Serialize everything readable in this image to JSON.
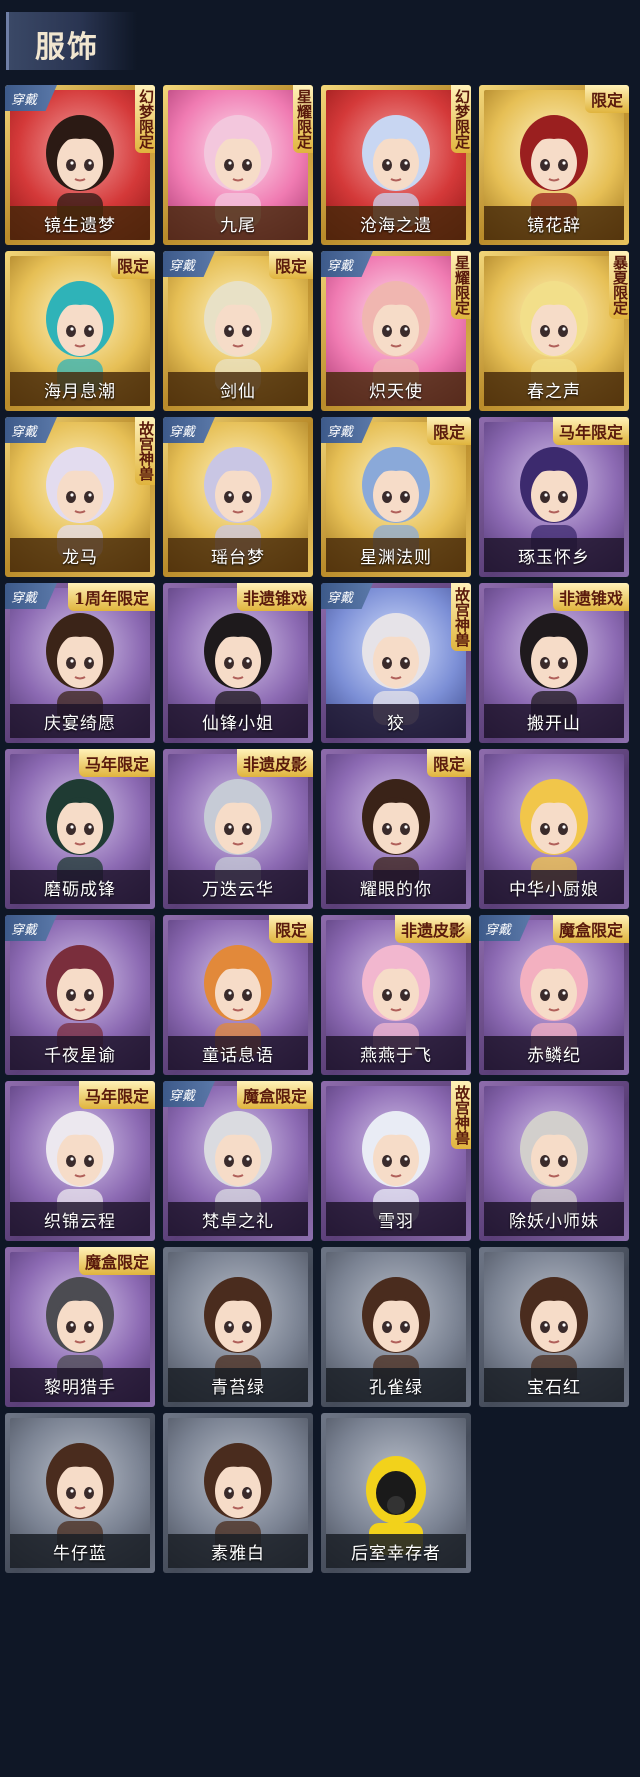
{
  "section_title": "服饰",
  "equipped_label": "穿戴",
  "items": [
    {
      "name": "镜生遗梦",
      "tag": "幻梦限定",
      "frame": "gold",
      "bg": "red",
      "equipped": true,
      "tag_style": "vertical",
      "hair": "#2b1a14"
    },
    {
      "name": "九尾",
      "tag": "星耀限定",
      "frame": "gold",
      "bg": "pink",
      "equipped": false,
      "tag_style": "vertical",
      "hair": "#f3c7dd"
    },
    {
      "name": "沧海之遗",
      "tag": "幻梦限定",
      "frame": "gold",
      "bg": "red",
      "equipped": false,
      "tag_style": "vertical",
      "hair": "#c8d6f2"
    },
    {
      "name": "镜花辞",
      "tag": "限定",
      "frame": "gold",
      "bg": "gold",
      "equipped": false,
      "tag_style": "plain",
      "hair": "#9a1f1f"
    },
    {
      "name": "海月息潮",
      "tag": "限定",
      "frame": "gold",
      "bg": "gold",
      "equipped": false,
      "tag_style": "plain",
      "hair": "#2fb3b8"
    },
    {
      "name": "剑仙",
      "tag": "限定",
      "frame": "gold",
      "bg": "gold",
      "equipped": true,
      "tag_style": "plain",
      "hair": "#e8e1c6"
    },
    {
      "name": "炽天使",
      "tag": "星耀限定",
      "frame": "gold",
      "bg": "pink",
      "equipped": true,
      "tag_style": "vertical",
      "hair": "#f0b6b0"
    },
    {
      "name": "春之声",
      "tag": "暴夏限定",
      "frame": "gold",
      "bg": "gold",
      "equipped": false,
      "tag_style": "vertical",
      "hair": "#f2df8a"
    },
    {
      "name": "龙马",
      "tag": "故宫神兽",
      "frame": "gold",
      "bg": "gold",
      "equipped": true,
      "tag_style": "vertical",
      "hair": "#e3dcef"
    },
    {
      "name": "瑶台梦",
      "tag": "",
      "frame": "gold",
      "bg": "gold",
      "equipped": true,
      "tag_style": "plain",
      "hair": "#c9c6e4"
    },
    {
      "name": "星渊法则",
      "tag": "限定",
      "frame": "gold",
      "bg": "gold",
      "equipped": true,
      "tag_style": "plain",
      "hair": "#8aa9d9"
    },
    {
      "name": "琢玉怀乡",
      "tag": "马年限定",
      "frame": "purple",
      "bg": "purple",
      "equipped": false,
      "tag_style": "plain",
      "hair": "#3c2a6e"
    },
    {
      "name": "庆宴绮愿",
      "tag": "1周年限定",
      "frame": "purple",
      "bg": "purple",
      "equipped": true,
      "tag_style": "plain",
      "hair": "#3b2418"
    },
    {
      "name": "仙锋小姐",
      "tag": "非遗锥戏",
      "frame": "purple",
      "bg": "purple",
      "equipped": false,
      "tag_style": "plain",
      "hair": "#1e1a1c"
    },
    {
      "name": "狡",
      "tag": "故宫神兽",
      "frame": "purple",
      "bg": "blue",
      "equipped": true,
      "tag_style": "vertical",
      "hair": "#e6e3e8"
    },
    {
      "name": "搬开山",
      "tag": "非遗锥戏",
      "frame": "purple",
      "bg": "purple",
      "equipped": false,
      "tag_style": "plain",
      "hair": "#1f1a1d"
    },
    {
      "name": "磨砺成锋",
      "tag": "马年限定",
      "frame": "purple",
      "bg": "purple",
      "equipped": false,
      "tag_style": "plain",
      "hair": "#1f3b33"
    },
    {
      "name": "万迭云华",
      "tag": "非遗皮影",
      "frame": "purple",
      "bg": "purple",
      "equipped": false,
      "tag_style": "plain",
      "hair": "#c6cbd6"
    },
    {
      "name": "耀眼的你",
      "tag": "限定",
      "frame": "purple",
      "bg": "purple",
      "equipped": false,
      "tag_style": "plain",
      "hair": "#3a2318"
    },
    {
      "name": "中华小厨娘",
      "tag": "",
      "frame": "purple",
      "bg": "purple",
      "equipped": false,
      "tag_style": "plain",
      "hair": "#f1c64a"
    },
    {
      "name": "千夜星谕",
      "tag": "",
      "frame": "purple",
      "bg": "purple",
      "equipped": true,
      "tag_style": "plain",
      "hair": "#7a2e3c"
    },
    {
      "name": "童话息语",
      "tag": "限定",
      "frame": "purple",
      "bg": "purple",
      "equipped": false,
      "tag_style": "plain",
      "hair": "#e2893a"
    },
    {
      "name": "燕燕于飞",
      "tag": "非遗皮影",
      "frame": "purple",
      "bg": "purple",
      "equipped": false,
      "tag_style": "plain",
      "hair": "#f2b7cf"
    },
    {
      "name": "赤鳞纪",
      "tag": "魔盒限定",
      "frame": "purple",
      "bg": "purple",
      "equipped": true,
      "tag_style": "plain",
      "hair": "#f3b0c0"
    },
    {
      "name": "织锦云程",
      "tag": "马年限定",
      "frame": "purple",
      "bg": "purple",
      "equipped": false,
      "tag_style": "plain",
      "hair": "#ece8ef"
    },
    {
      "name": "梵卓之礼",
      "tag": "魔盒限定",
      "frame": "purple",
      "bg": "purple",
      "equipped": true,
      "tag_style": "plain",
      "hair": "#dadbe0"
    },
    {
      "name": "雪羽",
      "tag": "故宫神兽",
      "frame": "purple",
      "bg": "purple",
      "equipped": false,
      "tag_style": "vertical",
      "hair": "#e9ecf5"
    },
    {
      "name": "除妖小师妹",
      "tag": "",
      "frame": "purple",
      "bg": "purple",
      "equipped": false,
      "tag_style": "plain",
      "hair": "#d2cfcc"
    },
    {
      "name": "黎明猎手",
      "tag": "魔盒限定",
      "frame": "purple",
      "bg": "purple",
      "equipped": false,
      "tag_style": "plain",
      "hair": "#4c4c52"
    },
    {
      "name": "青苔绿",
      "tag": "",
      "frame": "gray",
      "bg": "gray",
      "equipped": false,
      "tag_style": "plain",
      "hair": "#4a2c1e"
    },
    {
      "name": "孔雀绿",
      "tag": "",
      "frame": "gray",
      "bg": "gray",
      "equipped": false,
      "tag_style": "plain",
      "hair": "#4a2c1e"
    },
    {
      "name": "宝石红",
      "tag": "",
      "frame": "gray",
      "bg": "gray",
      "equipped": false,
      "tag_style": "plain",
      "hair": "#4a2c1e"
    },
    {
      "name": "牛仔蓝",
      "tag": "",
      "frame": "gray",
      "bg": "gray",
      "equipped": false,
      "tag_style": "plain",
      "hair": "#4a2c1e"
    },
    {
      "name": "素雅白",
      "tag": "",
      "frame": "gray",
      "bg": "gray",
      "equipped": false,
      "tag_style": "plain",
      "hair": "#4a2c1e"
    },
    {
      "name": "后室幸存者",
      "tag": "",
      "frame": "gray",
      "bg": "gray",
      "equipped": false,
      "tag_style": "plain",
      "hair": "#f2d21b"
    }
  ]
}
